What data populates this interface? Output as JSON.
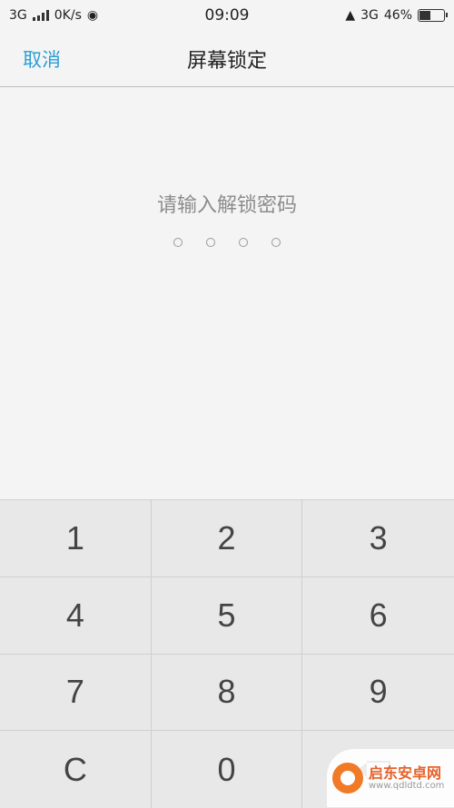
{
  "status_bar": {
    "network_left": "3G",
    "speed": "0K/s",
    "time": "09:09",
    "network_right": "3G",
    "battery_percent": "46%",
    "battery_level": 0.46
  },
  "header": {
    "cancel_label": "取消",
    "title": "屏幕锁定"
  },
  "prompt": "请输入解锁密码",
  "pin_length": 4,
  "keypad": {
    "keys": [
      "1",
      "2",
      "3",
      "4",
      "5",
      "6",
      "7",
      "8",
      "9",
      "C",
      "0"
    ]
  },
  "watermark": {
    "name": "启东安卓网",
    "url": "www.qdldtd.com"
  },
  "colors": {
    "accent": "#2a9fd6",
    "background": "#f4f4f4",
    "keypad": "#e8e8e8"
  }
}
